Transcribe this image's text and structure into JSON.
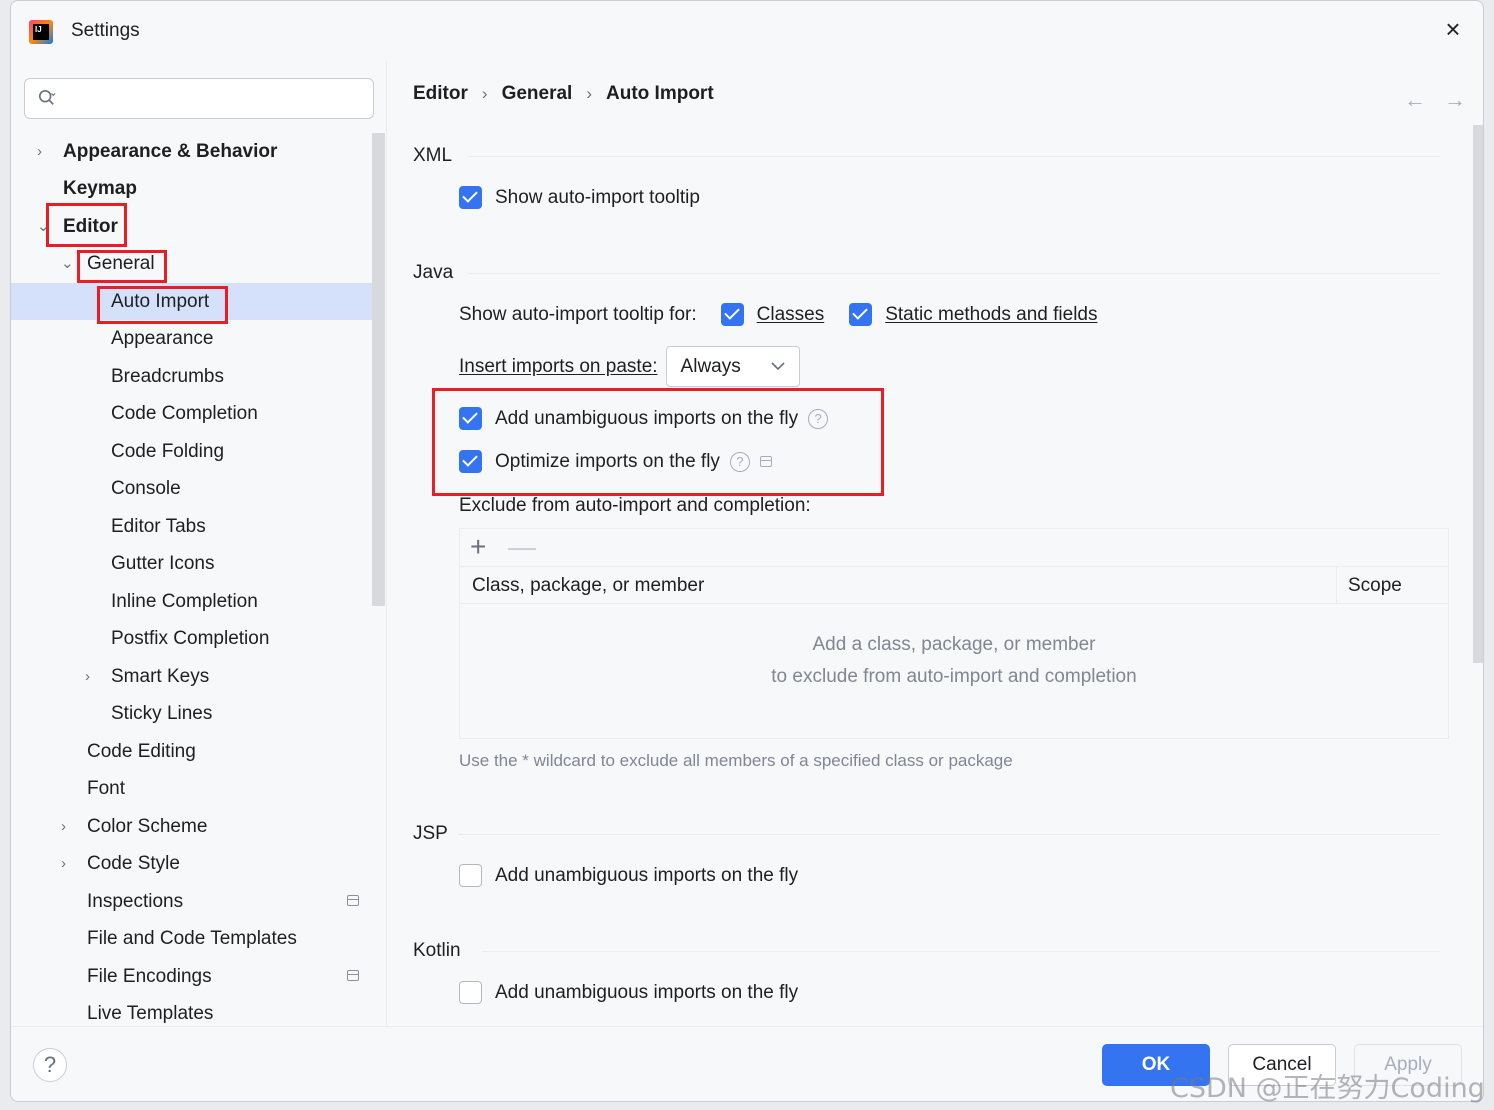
{
  "window": {
    "title": "Settings"
  },
  "sidebar": {
    "search_placeholder": "",
    "items": [
      {
        "label": "Appearance & Behavior",
        "chevron": "›"
      },
      {
        "label": "Keymap",
        "chevron": ""
      },
      {
        "label": "Editor",
        "chevron": "⌄"
      },
      {
        "label": "General",
        "chevron": "⌄"
      },
      {
        "label": "Auto Import",
        "chevron": ""
      },
      {
        "label": "Appearance",
        "chevron": ""
      },
      {
        "label": "Breadcrumbs",
        "chevron": ""
      },
      {
        "label": "Code Completion",
        "chevron": ""
      },
      {
        "label": "Code Folding",
        "chevron": ""
      },
      {
        "label": "Console",
        "chevron": ""
      },
      {
        "label": "Editor Tabs",
        "chevron": ""
      },
      {
        "label": "Gutter Icons",
        "chevron": ""
      },
      {
        "label": "Inline Completion",
        "chevron": ""
      },
      {
        "label": "Postfix Completion",
        "chevron": ""
      },
      {
        "label": "Smart Keys",
        "chevron": "›"
      },
      {
        "label": "Sticky Lines",
        "chevron": ""
      },
      {
        "label": "Code Editing",
        "chevron": ""
      },
      {
        "label": "Font",
        "chevron": ""
      },
      {
        "label": "Color Scheme",
        "chevron": "›"
      },
      {
        "label": "Code Style",
        "chevron": "›"
      },
      {
        "label": "Inspections",
        "chevron": ""
      },
      {
        "label": "File and Code Templates",
        "chevron": ""
      },
      {
        "label": "File Encodings",
        "chevron": ""
      },
      {
        "label": "Live Templates",
        "chevron": ""
      }
    ]
  },
  "breadcrumb": [
    "Editor",
    "General",
    "Auto Import"
  ],
  "breadcrumb_sep": "›",
  "nav": {
    "back": "←",
    "forward": "→"
  },
  "xml": {
    "title": "XML",
    "show_tooltip": {
      "label": "Show auto-import tooltip",
      "checked": true
    }
  },
  "java": {
    "title": "Java",
    "tooltip_for_label": "Show auto-import tooltip for:",
    "classes": {
      "label": "Classes",
      "checked": true
    },
    "static": {
      "label": "Static methods and fields",
      "checked": true
    },
    "paste_label": "Insert imports on paste:",
    "paste_value": "Always",
    "add_unambiguous": {
      "label": "Add unambiguous imports on the fly",
      "checked": true
    },
    "optimize": {
      "label": "Optimize imports on the fly",
      "checked": true
    },
    "exclude_label": "Exclude from auto-import and completion:",
    "table": {
      "add": "+",
      "remove": "—",
      "columns": [
        "Class, package, or member",
        "Scope"
      ],
      "empty_line1": "Add a class, package, or member",
      "empty_line2": "to exclude from auto-import and completion"
    },
    "hint": "Use the * wildcard to exclude all members of a specified class or package",
    "help_glyph": "?"
  },
  "jsp": {
    "title": "JSP",
    "add_unambiguous": {
      "label": "Add unambiguous imports on the fly",
      "checked": false
    }
  },
  "kotlin": {
    "title": "Kotlin",
    "add_unambiguous": {
      "label": "Add unambiguous imports on the fly",
      "checked": false
    }
  },
  "footer": {
    "help": "?",
    "ok": "OK",
    "cancel": "Cancel",
    "apply": "Apply"
  },
  "watermark": "CSDN @正在努力Coding",
  "colors": {
    "accent": "#3574f0",
    "selection": "#d5e1fb",
    "annotation": "#ea1c24"
  }
}
